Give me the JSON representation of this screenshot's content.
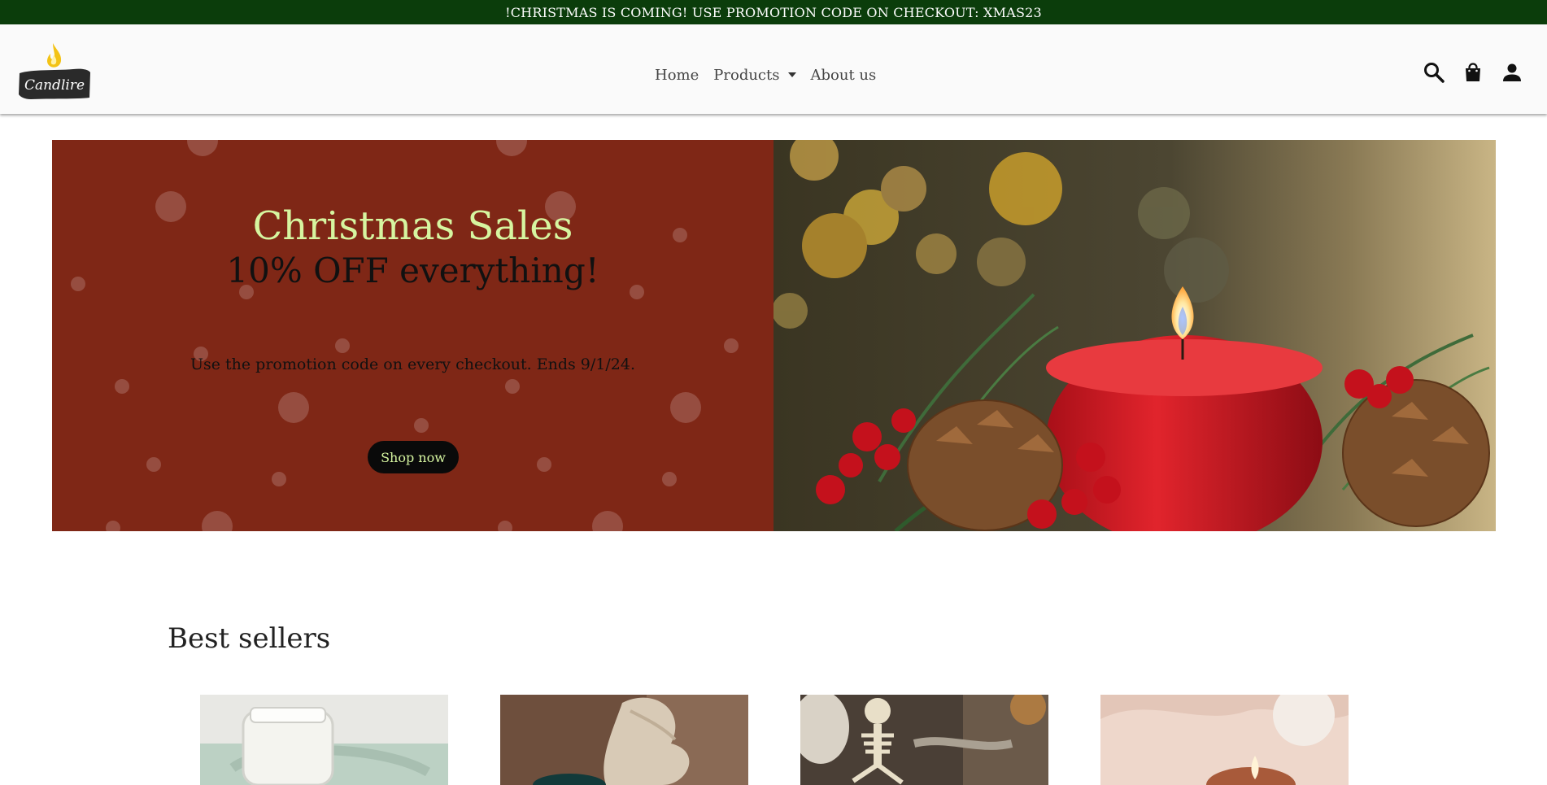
{
  "announcement": "!CHRISTMAS IS COMING! USE PROMOTION CODE ON CHECKOUT: XMAS23",
  "brand": {
    "name": "Candlire",
    "flame_color": "#f3c316"
  },
  "nav": {
    "items": [
      {
        "label": "Home"
      },
      {
        "label": "Products",
        "has_dropdown": true
      },
      {
        "label": "About us"
      }
    ]
  },
  "actions": {
    "icons": [
      "search-icon",
      "shopping-bag-icon",
      "user-icon"
    ]
  },
  "hero": {
    "title": "Christmas Sales",
    "subtitle": "10% OFF everything!",
    "description": "Use the promotion code on every checkout. Ends 9/1/24.",
    "button_label": "Shop now",
    "colors": {
      "panel": "#7f2716",
      "title": "#d6f5a0",
      "button": "#0a0a0a"
    }
  },
  "best_sellers": {
    "title": "Best sellers",
    "products": [
      {
        "image": "candle-jar-photo"
      },
      {
        "image": "gift-candle-photo"
      },
      {
        "image": "skeleton-candle-photo"
      },
      {
        "image": "lit-candle-photo"
      }
    ]
  },
  "colors": {
    "announce_bar": "#0b3d0b",
    "header": "#fafafa"
  }
}
